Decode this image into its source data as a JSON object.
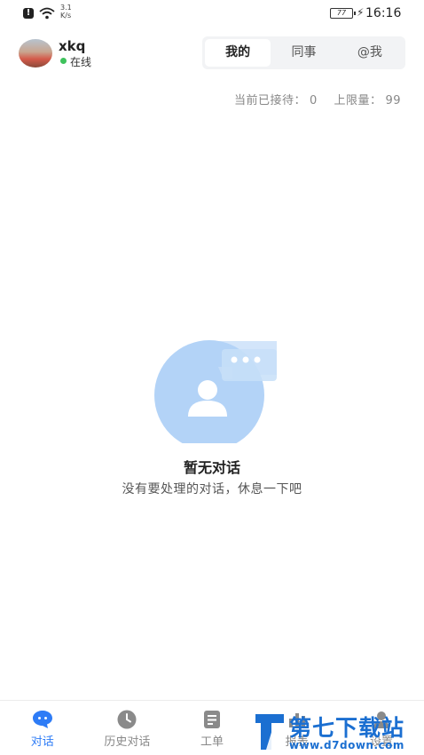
{
  "statusbar": {
    "network_speed_value": "3.1",
    "network_speed_unit": "K/s",
    "battery": "77",
    "time": "16:16"
  },
  "header": {
    "username": "xkq",
    "status": "在线"
  },
  "segment_tabs": [
    {
      "label": "我的",
      "active": true
    },
    {
      "label": "同事",
      "active": false
    },
    {
      "label": "@我",
      "active": false
    }
  ],
  "counts": {
    "current_label": "当前已接待：",
    "current_value": "0",
    "limit_label": "上限量：",
    "limit_value": "99"
  },
  "empty_state": {
    "title": "暂无对话",
    "subtitle": "没有要处理的对话，休息一下吧"
  },
  "bottom_nav": [
    {
      "label": "对话",
      "icon": "chat-bubble-icon",
      "active": true
    },
    {
      "label": "历史对话",
      "icon": "clock-icon",
      "active": false
    },
    {
      "label": "工单",
      "icon": "document-icon",
      "active": false
    },
    {
      "label": "报表",
      "icon": "chart-icon",
      "active": false
    },
    {
      "label": "设置",
      "icon": "user-settings-icon",
      "active": false
    }
  ],
  "watermark": {
    "text": "第七下载站",
    "url": "www.d7down.com"
  },
  "colors": {
    "accent": "#2e7cf6",
    "illustration": "#b3d3f7",
    "online": "#3ec25c",
    "watermark": "#1b6fd1"
  }
}
